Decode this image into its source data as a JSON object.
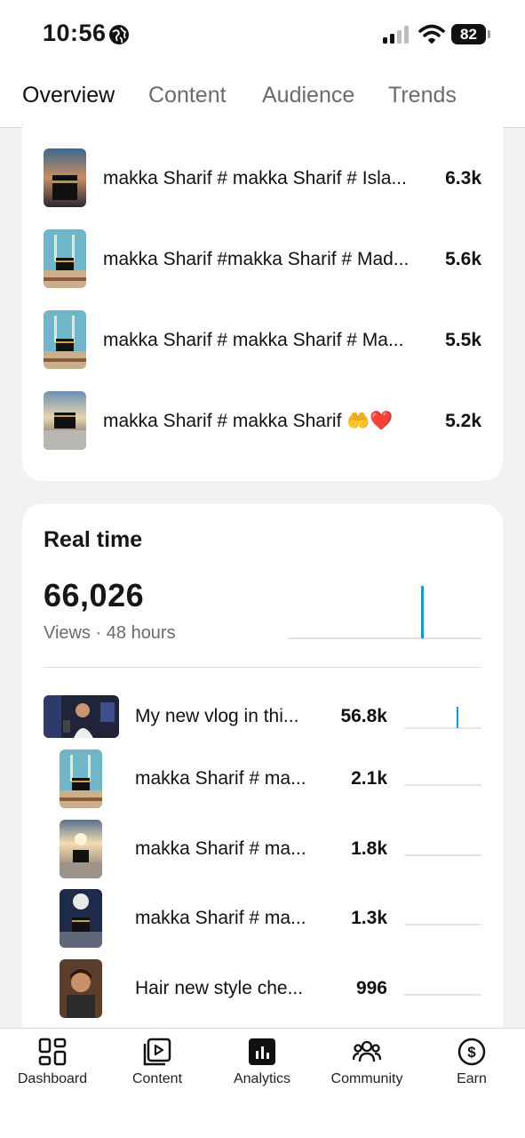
{
  "status_bar": {
    "time": "10:56",
    "battery": "82"
  },
  "tabs": [
    {
      "label": "Overview",
      "active": true
    },
    {
      "label": "Content",
      "active": false
    },
    {
      "label": "Audience",
      "active": false
    },
    {
      "label": "Trends",
      "active": false
    }
  ],
  "top_content": [
    {
      "title": "makka Sharif # makka Sharif # Isla...",
      "value": "6.3k",
      "thumb": "kaaba-night"
    },
    {
      "title": "makka Sharif #makka Sharif # Mad...",
      "value": "5.6k",
      "thumb": "kaaba-tower-day"
    },
    {
      "title": "makka Sharif # makka Sharif # Ma...",
      "value": "5.5k",
      "thumb": "kaaba-tower-day"
    },
    {
      "title": "makka Sharif # makka Sharif 🤲❤️",
      "value": "5.2k",
      "thumb": "kaaba-crowd"
    }
  ],
  "realtime": {
    "title": "Real time",
    "views": "66,026",
    "subtitle": "Views · 48 hours",
    "accent_color": "#1a9bc4",
    "items": [
      {
        "title": "My new vlog in thi...",
        "value": "56.8k",
        "thumb": "vlog-studio",
        "spike": true
      },
      {
        "title": "makka Sharif # ma...",
        "value": "2.1k",
        "thumb": "kaaba-tower-day",
        "spike": false
      },
      {
        "title": "makka Sharif # ma...",
        "value": "1.8k",
        "thumb": "kaaba-sunset",
        "spike": false
      },
      {
        "title": "makka Sharif # ma...",
        "value": "1.3k",
        "thumb": "kaaba-moon",
        "spike": false
      },
      {
        "title": "Hair new style che...",
        "value": "996",
        "thumb": "barber",
        "spike": false
      }
    ]
  },
  "bottom_nav": [
    {
      "label": "Dashboard",
      "icon": "dashboard-icon"
    },
    {
      "label": "Content",
      "icon": "content-icon"
    },
    {
      "label": "Analytics",
      "icon": "analytics-icon",
      "active": true
    },
    {
      "label": "Community",
      "icon": "community-icon"
    },
    {
      "label": "Earn",
      "icon": "earn-icon"
    }
  ]
}
